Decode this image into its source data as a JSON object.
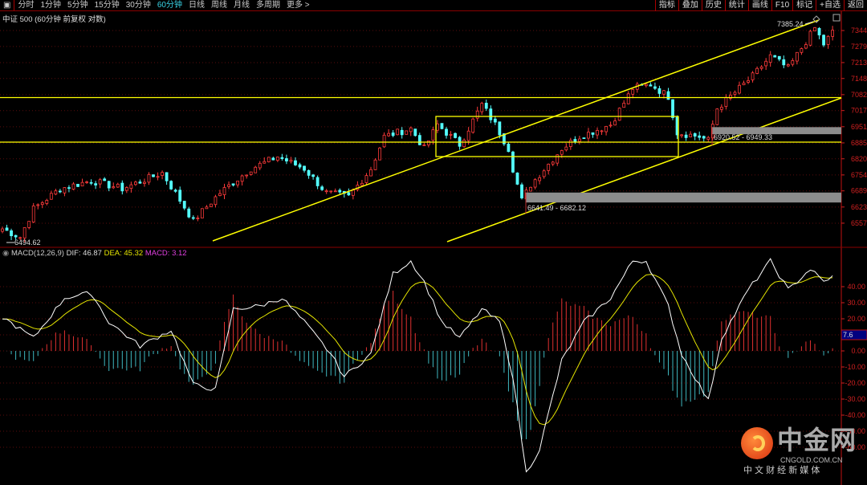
{
  "toolbar": {
    "left_icon": "panel-toggle-icon",
    "periods": [
      "分时",
      "1分钟",
      "5分钟",
      "15分钟",
      "30分钟",
      "60分钟",
      "日线",
      "周线",
      "月线",
      "多周期",
      "更多 >"
    ],
    "active_period": "60分钟",
    "right_buttons": [
      "指标",
      "叠加",
      "历史",
      "统计",
      "画线",
      "F10",
      "标记",
      "+自选",
      "返回"
    ]
  },
  "title": "中证 500 (60分钟 前复权 对数)",
  "macd_header": {
    "name": "MACD(12,26,9)",
    "dif": "DIF: 46.87",
    "dea": "DEA: 45.32",
    "macd": "MACD: 3.12"
  },
  "colors": {
    "up": "#ff3b3b",
    "down": "#54ffff",
    "dif": "#ffffff",
    "dea": "#e6e600",
    "drawing": "#ffff00",
    "axis": "#d02020"
  },
  "annotations": {
    "high": "7385.24",
    "low": "6494.62",
    "zone1": "6641.49 - 6682.12",
    "zone2": "6920.52 - 6949.33",
    "macd_marker": "7.6"
  },
  "logo": {
    "name": "中金网",
    "url_text": "CNGOLD.COM.CN",
    "slogan": "中 文 财 经 新 媒 体"
  },
  "chart_data": [
    {
      "type": "candlestick",
      "title": "中证 500 60分钟",
      "y_ticks": [
        7344,
        7279,
        7213,
        7148,
        7082,
        7017,
        6951,
        6885,
        6820,
        6754,
        6689,
        6623,
        6557
      ],
      "ylim": [
        6480,
        7400
      ],
      "close_keypoints": [
        [
          0,
          6534
        ],
        [
          4,
          6500
        ],
        [
          7,
          6616
        ],
        [
          13,
          6698
        ],
        [
          20,
          6731
        ],
        [
          27,
          6698
        ],
        [
          36,
          6763
        ],
        [
          43,
          6567
        ],
        [
          49,
          6681
        ],
        [
          56,
          6780
        ],
        [
          62,
          6829
        ],
        [
          68,
          6780
        ],
        [
          73,
          6681
        ],
        [
          78,
          6665
        ],
        [
          83,
          6780
        ],
        [
          86,
          6911
        ],
        [
          92,
          6944
        ],
        [
          95,
          6862
        ],
        [
          98,
          6960
        ],
        [
          103,
          6878
        ],
        [
          108,
          7042
        ],
        [
          111,
          6960
        ],
        [
          114,
          6862
        ],
        [
          115,
          6780
        ],
        [
          117,
          6650
        ],
        [
          119,
          6714
        ],
        [
          126,
          6862
        ],
        [
          130,
          6911
        ],
        [
          137,
          6960
        ],
        [
          142,
          7108
        ],
        [
          146,
          7124
        ],
        [
          150,
          7075
        ],
        [
          152,
          6927
        ],
        [
          157,
          6911
        ],
        [
          159,
          6895
        ],
        [
          161,
          7026
        ],
        [
          166,
          7108
        ],
        [
          169,
          7157
        ],
        [
          173,
          7239
        ],
        [
          177,
          7190
        ],
        [
          180,
          7272
        ],
        [
          183,
          7354
        ],
        [
          185,
          7288
        ],
        [
          187,
          7337
        ]
      ],
      "horizontal_lines": [
        7070,
        6888
      ],
      "zones": [
        [
          6641.49,
          6682.12
        ],
        [
          6920.52,
          6949.33
        ]
      ],
      "high": 7385.24,
      "low": 6494.62
    },
    {
      "type": "line",
      "title": "MACD(12,26,9)",
      "y_ticks": [
        40,
        30,
        20,
        10,
        0,
        -10,
        -20,
        -30,
        -40,
        -50,
        -60
      ],
      "y_tick_labels": [
        "40.00",
        "30.00",
        "20.00",
        "",
        "0.00",
        "-10.00",
        "-20.00",
        "-30.00",
        "-40.00",
        "-50.00",
        "-60.00"
      ],
      "dif_keypoints": [
        [
          0,
          21
        ],
        [
          7,
          8
        ],
        [
          14,
          33
        ],
        [
          20,
          36
        ],
        [
          24,
          18
        ],
        [
          31,
          3
        ],
        [
          38,
          13
        ],
        [
          43,
          -21
        ],
        [
          48,
          -24
        ],
        [
          52,
          26
        ],
        [
          58,
          28
        ],
        [
          63,
          33
        ],
        [
          68,
          18
        ],
        [
          74,
          -2
        ],
        [
          77,
          -16
        ],
        [
          83,
          -2
        ],
        [
          88,
          48
        ],
        [
          92,
          56
        ],
        [
          95,
          43
        ],
        [
          99,
          18
        ],
        [
          103,
          8
        ],
        [
          108,
          26
        ],
        [
          112,
          18
        ],
        [
          115,
          -16
        ],
        [
          118,
          -76
        ],
        [
          121,
          -61
        ],
        [
          126,
          -6
        ],
        [
          131,
          18
        ],
        [
          137,
          33
        ],
        [
          142,
          56
        ],
        [
          145,
          56
        ],
        [
          150,
          28
        ],
        [
          153,
          -2
        ],
        [
          159,
          -31
        ],
        [
          162,
          8
        ],
        [
          168,
          38
        ],
        [
          173,
          56
        ],
        [
          177,
          38
        ],
        [
          182,
          51
        ],
        [
          185,
          43
        ],
        [
          187,
          46.87
        ]
      ],
      "last": {
        "dif": 46.87,
        "dea": 45.32,
        "macd": 3.12
      }
    }
  ]
}
